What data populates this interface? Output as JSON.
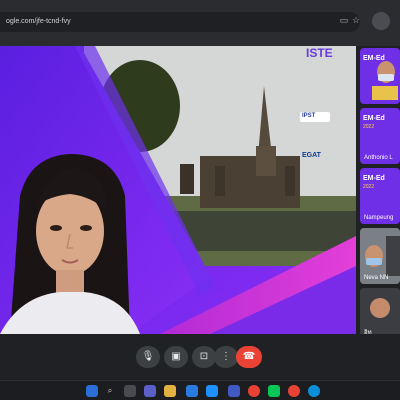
{
  "browser": {
    "url": "ogle.com/jfe-tcnd-fvy"
  },
  "icons": {
    "camera_status": "camera-icon",
    "bookmark": "bookmark-star-icon",
    "profile": "profile-icon"
  },
  "slide": {
    "logo_partial": "ISTE",
    "brand_logo": "EGAT",
    "brand_logo_small": "IPST"
  },
  "participants": [
    {
      "name": "",
      "badge": "EM-Ed",
      "year": ""
    },
    {
      "name": "Anthonio L",
      "badge": "EM-Ed",
      "year": "2022"
    },
    {
      "name": "Nampeung",
      "badge": "EM-Ed",
      "year": "2022"
    },
    {
      "name": "Neva NN",
      "badge": "",
      "year": ""
    },
    {
      "name": "อิท",
      "badge": "",
      "year": ""
    }
  ],
  "controls": {
    "mic": "microphone-icon",
    "camera": "video-camera-icon",
    "present": "present-screen-icon",
    "more": "more-options-icon",
    "hangup": "hang-up-icon"
  },
  "colors": {
    "accent_purple": "#6c2ef0",
    "hangup_red": "#ea4335"
  }
}
